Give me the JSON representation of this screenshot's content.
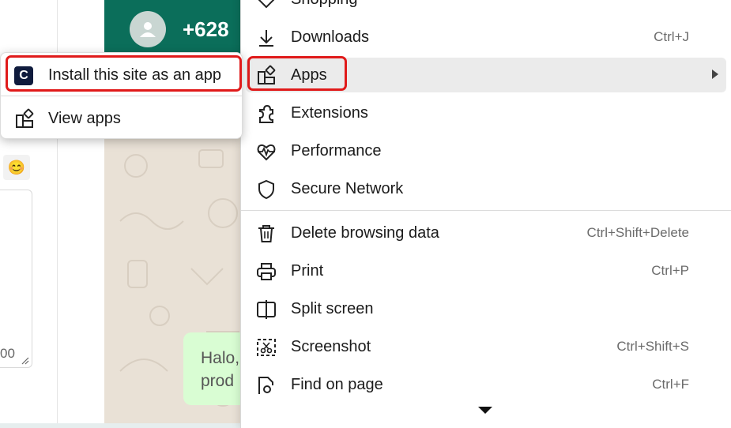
{
  "background": {
    "contact_phone": "+628",
    "message_preview_line1": "Halo,",
    "message_preview_line2": "prod",
    "left_number": "00",
    "emoji_icon": "smiling-face-icon",
    "colors": {
      "header": "#0b6e5a",
      "bubble": "#d9fdd3",
      "chat_bg": "#e9e1d6"
    }
  },
  "menu": {
    "items": [
      {
        "label": "Shopping",
        "shortcut": "",
        "icon": "heart-tag-icon"
      },
      {
        "label": "Downloads",
        "shortcut": "Ctrl+J",
        "icon": "download-icon"
      },
      {
        "label": "Apps",
        "shortcut": "",
        "icon": "apps-icon",
        "has_submenu": true,
        "highlighted": true
      },
      {
        "label": "Extensions",
        "shortcut": "",
        "icon": "puzzle-icon"
      },
      {
        "label": "Performance",
        "shortcut": "",
        "icon": "heartbeat-icon"
      },
      {
        "label": "Secure Network",
        "shortcut": "",
        "icon": "shield-icon"
      },
      {
        "label": "Delete browsing data",
        "shortcut": "Ctrl+Shift+Delete",
        "icon": "trash-icon"
      },
      {
        "label": "Print",
        "shortcut": "Ctrl+P",
        "icon": "printer-icon"
      },
      {
        "label": "Split screen",
        "shortcut": "",
        "icon": "split-screen-icon"
      },
      {
        "label": "Screenshot",
        "shortcut": "Ctrl+Shift+S",
        "icon": "screenshot-icon"
      },
      {
        "label": "Find on page",
        "shortcut": "Ctrl+F",
        "icon": "find-icon"
      }
    ]
  },
  "submenu": {
    "install_label": "Install this site as an app",
    "install_icon_letter": "C",
    "view_label": "View apps"
  },
  "annotation_color": "#e01a1a"
}
